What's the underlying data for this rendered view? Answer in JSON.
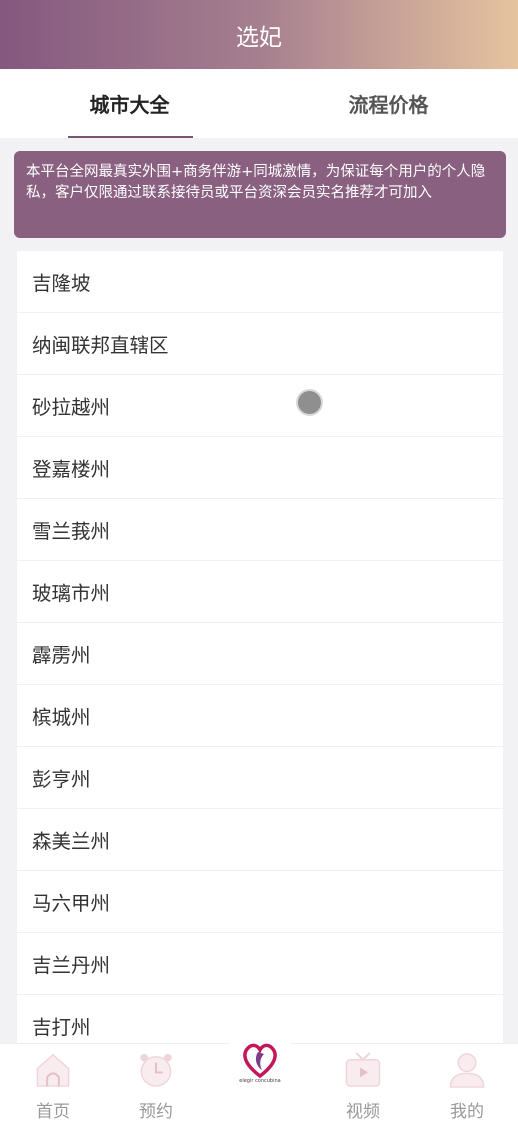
{
  "header": {
    "title": "选妃"
  },
  "tabs": [
    {
      "label": "城市大全",
      "active": true
    },
    {
      "label": "流程价格",
      "active": false
    }
  ],
  "notice": {
    "text": "本平台全网最真实外围+商务伴游+同城激情，为保证每个用户的个人隐私，客户仅限通过联系接待员或平台资深会员实名推荐才可加入"
  },
  "cities": [
    "吉隆坡",
    "纳闽联邦直辖区",
    "砂拉越州",
    "登嘉楼州",
    "雪兰莪州",
    "玻璃市州",
    "霹雳州",
    "槟城州",
    "彭亨州",
    "森美兰州",
    "马六甲州",
    "吉兰丹州",
    "吉打州"
  ],
  "tabbar": {
    "items": [
      {
        "label": "首页",
        "icon": "home-icon"
      },
      {
        "label": "预约",
        "icon": "alarm-clock-icon"
      },
      {
        "label": "视频",
        "icon": "tv-icon"
      },
      {
        "label": "我的",
        "icon": "user-icon"
      }
    ],
    "center_logo_text": "elegir concubina"
  },
  "colors": {
    "accent": "#8a6080",
    "header_start": "#84587f",
    "header_end": "#e6c39f"
  }
}
